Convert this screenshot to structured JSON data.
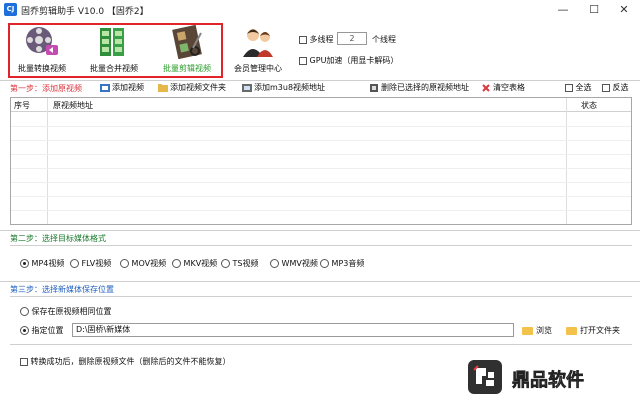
{
  "window": {
    "title": "固乔剪辑助手 V10.0 【固乔2】",
    "app_icon_text": "CJ",
    "minimize": "—",
    "maximize": "☐",
    "close": "✕"
  },
  "toolbar": {
    "batch_convert": "批量转换视频",
    "batch_merge": "批量合并视频",
    "batch_edit": "批量剪辑视频",
    "member_center": "会员管理中心",
    "multithread_label": "多线程",
    "thread_count": "2",
    "thread_unit": "个线程",
    "gpu_label": "GPU加速（用显卡解码）"
  },
  "step1": {
    "title": "第一步：添加原视频",
    "add_video": "添加视频",
    "add_folder": "添加视频文件夹",
    "add_m3u8": "添加m3u8视频地址",
    "delete_selected": "删除已选择的原视频地址",
    "clear_table": "清空表格",
    "select_all": "全选",
    "invert": "反选"
  },
  "table": {
    "columns": [
      "序号",
      "原视频地址",
      "状态"
    ],
    "rows": []
  },
  "step2": {
    "title": "第二步：选择目标媒体格式",
    "selected": "MP4视频",
    "formats": [
      "MP4视频",
      "FLV视频",
      "MOV视频",
      "MKV视频",
      "TS视频",
      "WMV视频",
      "MP3音频"
    ]
  },
  "step3": {
    "title": "第三步：选择新媒体保存位置",
    "option_same": "保存在原视频相同位置",
    "option_custom": "指定位置",
    "path": "D:\\固桥\\新媒体",
    "browse": "浏览",
    "open_folder": "打开文件夹"
  },
  "footer": {
    "delete_after": "转换成功后，删除原视频文件（删除后的文件不能恢复）"
  },
  "watermark": {
    "text": "鼎品软件"
  },
  "colors": {
    "highlight_box": "#e0242a",
    "step1": "#d9363e",
    "step2": "#1a7a2c",
    "step3": "#1f5fbf",
    "active_tool": "#2a9d2a"
  }
}
